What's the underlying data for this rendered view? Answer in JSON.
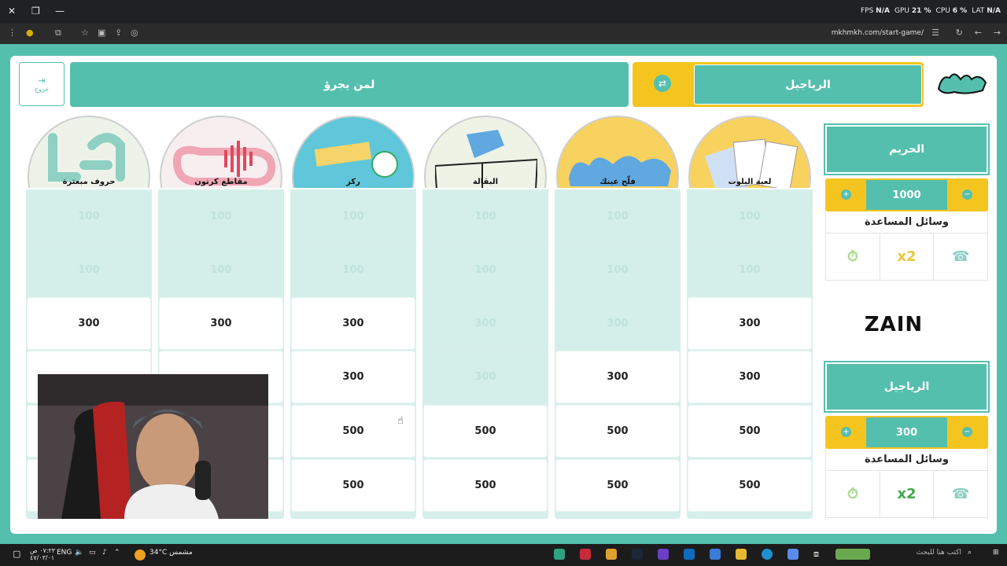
{
  "browser": {
    "url": "mkhmkh.com/start-game/",
    "overlay": [
      {
        "label": "FPS",
        "value": "N/A"
      },
      {
        "label": "GPU",
        "value": "21 %"
      },
      {
        "label": "CPU",
        "value": "6 %"
      },
      {
        "label": "LAT",
        "value": "N/A"
      }
    ]
  },
  "header": {
    "exit_label": "خروج",
    "turn_label": "لمن يجرؤ",
    "current_team": "الرياجيل"
  },
  "categories": [
    {
      "label": "حروف مبعثرة"
    },
    {
      "label": "مقاطع كرتون"
    },
    {
      "label": "ركز"
    },
    {
      "label": "البقالة"
    },
    {
      "label": "فلّح عينك"
    },
    {
      "label": "لعبة البلوت"
    }
  ],
  "board": {
    "columns": [
      [
        {
          "v": "100",
          "used": true
        },
        {
          "v": "100",
          "used": true
        },
        {
          "v": "300",
          "used": false
        },
        {
          "v": "",
          "used": false
        },
        {
          "v": "",
          "used": false
        },
        {
          "v": "",
          "used": false
        }
      ],
      [
        {
          "v": "100",
          "used": true
        },
        {
          "v": "100",
          "used": true
        },
        {
          "v": "300",
          "used": false
        },
        {
          "v": "",
          "used": false
        },
        {
          "v": "",
          "used": false
        },
        {
          "v": "",
          "used": false
        }
      ],
      [
        {
          "v": "100",
          "used": true
        },
        {
          "v": "100",
          "used": true
        },
        {
          "v": "300",
          "used": false
        },
        {
          "v": "300",
          "used": false
        },
        {
          "v": "500",
          "used": false
        },
        {
          "v": "500",
          "used": false
        }
      ],
      [
        {
          "v": "100",
          "used": true
        },
        {
          "v": "100",
          "used": true
        },
        {
          "v": "300",
          "used": true
        },
        {
          "v": "300",
          "used": true
        },
        {
          "v": "500",
          "used": false
        },
        {
          "v": "500",
          "used": false
        }
      ],
      [
        {
          "v": "100",
          "used": true
        },
        {
          "v": "100",
          "used": true
        },
        {
          "v": "300",
          "used": true
        },
        {
          "v": "300",
          "used": false
        },
        {
          "v": "500",
          "used": false
        },
        {
          "v": "500",
          "used": false
        }
      ],
      [
        {
          "v": "100",
          "used": true
        },
        {
          "v": "100",
          "used": true
        },
        {
          "v": "300",
          "used": false
        },
        {
          "v": "300",
          "used": false
        },
        {
          "v": "500",
          "used": false
        },
        {
          "v": "500",
          "used": false
        }
      ]
    ]
  },
  "teams": [
    {
      "name": "الحريم",
      "score": "1000",
      "aids_title": "وسائل المساعدة",
      "aids": [
        "⏱",
        "x2",
        "☎"
      ]
    },
    {
      "name": "الرياجيل",
      "score": "300",
      "aids_title": "وسائل المساعدة",
      "aids": [
        "⏱",
        "x2",
        "☎"
      ]
    }
  ],
  "sponsor": "ZAIN",
  "taskbar": {
    "search_placeholder": "اكتب هنا للبحث",
    "weather": "34°C  مشمس",
    "lang": "ENG",
    "time": "٠٧:٢٣ ص",
    "date": "٤٧/٠٣/٠١"
  },
  "colors": {
    "teal": "#55bfae",
    "yellow": "#f5c51f",
    "used_cell": "#d4eee9"
  }
}
